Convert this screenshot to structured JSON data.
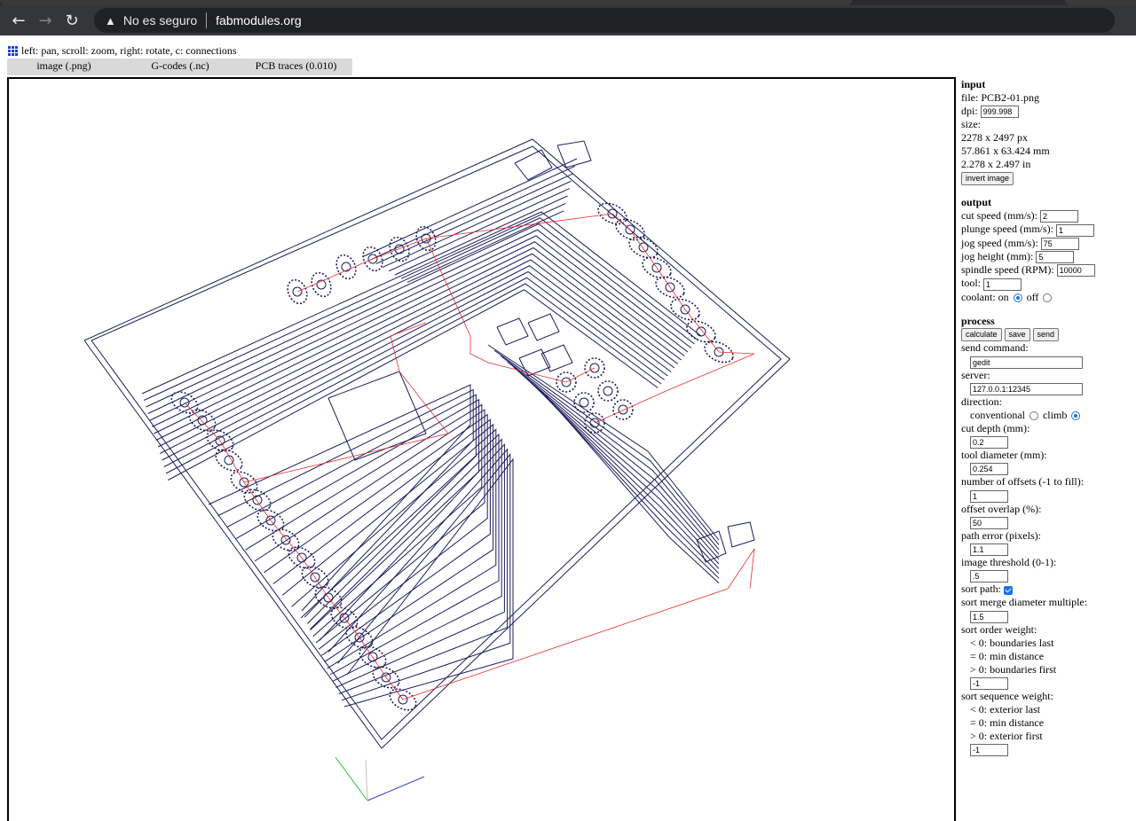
{
  "browser": {
    "security_label": "No es seguro",
    "url": "fabmodules.org"
  },
  "help_text": "left: pan, scroll: zoom, right: rotate, c: connections",
  "menu": [
    "image (.png)",
    "G-codes (.nc)",
    "PCB traces (0.010)"
  ],
  "input": {
    "title": "input",
    "file": "file: PCB2-01.png",
    "dpi_label": "dpi:",
    "dpi_value": "999.998",
    "size_label": "size:",
    "size_px": "2278 x 2497 px",
    "size_mm": "57.861 x 63.424 mm",
    "size_in": "2.278 x 2.497 in",
    "invert_button": "invert image"
  },
  "output": {
    "title": "output",
    "cut_speed_label": "cut speed (mm/s):",
    "cut_speed": "2",
    "plunge_speed_label": "plunge speed (mm/s):",
    "plunge_speed": "1",
    "jog_speed_label": "jog speed (mm/s):",
    "jog_speed": "75",
    "jog_height_label": "jog height (mm):",
    "jog_height": "5",
    "spindle_speed_label": "spindle speed (RPM):",
    "spindle_speed": "10000",
    "tool_label": "tool:",
    "tool": "1",
    "coolant_label": "coolant: on",
    "coolant_off_label": "off",
    "coolant": "on"
  },
  "process": {
    "title": "process",
    "calculate_button": "calculate",
    "save_button": "save",
    "send_button": "send",
    "send_command_label": "send command:",
    "send_command": "gedit",
    "server_label": "server:",
    "server": "127.0.0.1:12345",
    "direction_label": "direction:",
    "conventional_label": "conventional",
    "climb_label": "climb",
    "direction": "climb",
    "cut_depth_label": "cut depth (mm):",
    "cut_depth": "0.2",
    "tool_diameter_label": "tool diameter (mm):",
    "tool_diameter": "0.254",
    "offsets_label": "number of offsets (-1 to fill):",
    "offsets": "1",
    "overlap_label": "offset overlap (%):",
    "overlap": "50",
    "path_error_label": "path error (pixels):",
    "path_error": "1.1",
    "threshold_label": "image threshold (0-1):",
    "threshold": ".5",
    "sort_path_label": "sort path:",
    "sort_path": true,
    "merge_label": "sort merge diameter multiple:",
    "merge": "1.5",
    "order_weight_label": "sort order weight:",
    "order_lt": "< 0: boundaries last",
    "order_eq": "= 0: min distance",
    "order_gt": "> 0: boundaries first",
    "order_weight": "-1",
    "sequence_weight_label": "sort sequence weight:",
    "seq_lt": "< 0: exterior last",
    "seq_eq": "= 0: min distance",
    "seq_gt": "> 0: exterior first",
    "sequence_weight": "-1"
  },
  "colors": {
    "toolpath": "#1c1c5c",
    "jog_moves": "#e83030",
    "axis_x": "#3040c0",
    "axis_y": "#30c040"
  }
}
